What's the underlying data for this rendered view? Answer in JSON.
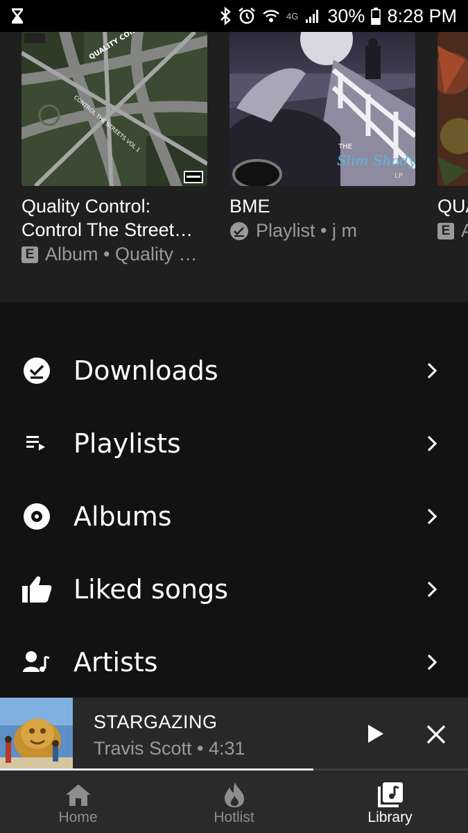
{
  "status_bar": {
    "battery": "30%",
    "time": "8:28 PM",
    "network": "4G"
  },
  "shelf": {
    "cards": [
      {
        "title": "Quality Control: Control The Street…",
        "meta": "Album • Quality …",
        "badge": "E",
        "art_text_1": "QUALITY CONTROL",
        "art_text_2": "CONTROL THE STREETS VOL 1"
      },
      {
        "title": "BME",
        "meta": "Playlist • j m",
        "badge": "downloaded-icon",
        "art_text_1": "THE",
        "art_text_2": "Slim Shady",
        "art_text_3": "LP"
      },
      {
        "title": "QUA",
        "meta": "A",
        "badge": "E"
      }
    ]
  },
  "menu": {
    "items": [
      {
        "label": "Downloads",
        "icon": "download-check-icon"
      },
      {
        "label": "Playlists",
        "icon": "playlist-icon"
      },
      {
        "label": "Albums",
        "icon": "album-icon"
      },
      {
        "label": "Liked songs",
        "icon": "thumbs-up-icon"
      },
      {
        "label": "Artists",
        "icon": "artist-icon"
      }
    ]
  },
  "now_playing": {
    "title": "STARGAZING",
    "subtitle": "Travis Scott • 4:31",
    "progress": 0.67
  },
  "bottom_nav": {
    "items": [
      {
        "label": "Home",
        "icon": "home-icon",
        "active": false
      },
      {
        "label": "Hotlist",
        "icon": "flame-icon",
        "active": false
      },
      {
        "label": "Library",
        "icon": "library-icon",
        "active": true
      }
    ]
  },
  "colors": {
    "background": "#121212",
    "shelf": "#1f1f1f",
    "secondary_text": "#9a9a9a",
    "nav_inactive": "#8e8e8e",
    "nav_active": "#ffffff"
  }
}
